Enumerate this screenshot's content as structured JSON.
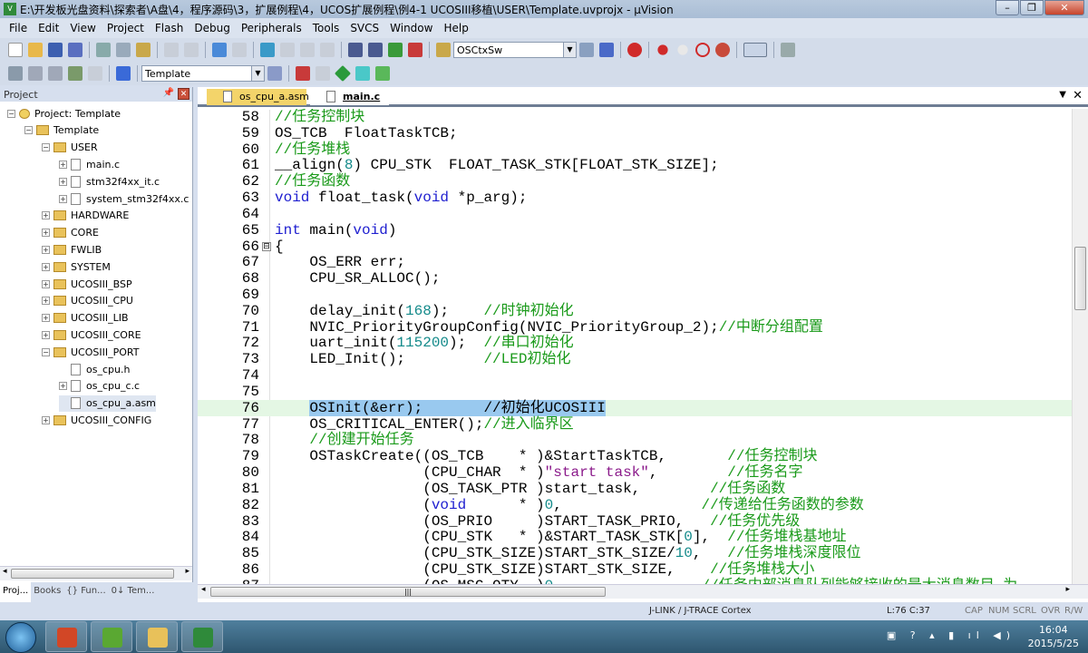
{
  "window": {
    "title": "E:\\开发板光盘资料\\探索者\\A盘\\4，程序源码\\3，扩展例程\\4，UCOS扩展例程\\例4-1 UCOSIII移植\\USER\\Template.uvprojx - µVision",
    "icon": "uvision-icon",
    "buttons": [
      "–",
      "❐",
      "✕"
    ]
  },
  "menu": [
    "File",
    "Edit",
    "View",
    "Project",
    "Flash",
    "Debug",
    "Peripherals",
    "Tools",
    "SVCS",
    "Window",
    "Help"
  ],
  "toolbar": {
    "find_combo": "OSCtxSw",
    "target_combo": "Template"
  },
  "project_panel": {
    "title": "Project",
    "pin": "ᵖ",
    "close": "✕",
    "tree": [
      {
        "label": "Project: Template",
        "level": 0,
        "type": "root",
        "exp": "−"
      },
      {
        "label": "Template",
        "level": 1,
        "type": "folder",
        "exp": "−"
      },
      {
        "label": "USER",
        "level": 2,
        "type": "folder",
        "exp": "−"
      },
      {
        "label": "main.c",
        "level": 3,
        "type": "file",
        "exp": "+"
      },
      {
        "label": "stm32f4xx_it.c",
        "level": 3,
        "type": "file",
        "exp": "+"
      },
      {
        "label": "system_stm32f4xx.c",
        "level": 3,
        "type": "file",
        "exp": "+"
      },
      {
        "label": "HARDWARE",
        "level": 2,
        "type": "folder",
        "exp": "+"
      },
      {
        "label": "CORE",
        "level": 2,
        "type": "folder",
        "exp": "+"
      },
      {
        "label": "FWLIB",
        "level": 2,
        "type": "folder",
        "exp": "+"
      },
      {
        "label": "SYSTEM",
        "level": 2,
        "type": "folder",
        "exp": "+"
      },
      {
        "label": "UCOSIII_BSP",
        "level": 2,
        "type": "folder",
        "exp": "+"
      },
      {
        "label": "UCOSIII_CPU",
        "level": 2,
        "type": "folder",
        "exp": "+"
      },
      {
        "label": "UCOSIII_LIB",
        "level": 2,
        "type": "folder",
        "exp": "+"
      },
      {
        "label": "UCOSIII_CORE",
        "level": 2,
        "type": "folder",
        "exp": "+"
      },
      {
        "label": "UCOSIII_PORT",
        "level": 2,
        "type": "folder",
        "exp": "−"
      },
      {
        "label": "os_cpu.h",
        "level": 3,
        "type": "file",
        "exp": ""
      },
      {
        "label": "os_cpu_c.c",
        "level": 3,
        "type": "file",
        "exp": "+"
      },
      {
        "label": "os_cpu_a.asm",
        "level": 3,
        "type": "file",
        "exp": "",
        "selected": true
      },
      {
        "label": "UCOSIII_CONFIG",
        "level": 2,
        "type": "folder",
        "exp": "+"
      }
    ],
    "tabs": [
      "Proj...",
      "Books",
      "{} Fun...",
      "0↓ Tem..."
    ]
  },
  "editor": {
    "tabs": [
      {
        "label": "os_cpu_a.asm",
        "active": false
      },
      {
        "label": "main.c",
        "active": true
      }
    ],
    "current_line": 76,
    "lines": [
      {
        "no": 58,
        "seg": [
          [
            "//任务控制块",
            "c"
          ]
        ]
      },
      {
        "no": 59,
        "seg": [
          [
            "OS_TCB  FloatTaskTCB;",
            ""
          ]
        ]
      },
      {
        "no": 60,
        "seg": [
          [
            "//任务堆栈",
            "c"
          ]
        ]
      },
      {
        "no": 61,
        "seg": [
          [
            "__align(",
            ""
          ],
          [
            "8",
            "n"
          ],
          [
            ") CPU_STK  FLOAT_TASK_STK[FLOAT_STK_SIZE];",
            ""
          ]
        ]
      },
      {
        "no": 62,
        "seg": [
          [
            "//任务函数",
            "c"
          ]
        ]
      },
      {
        "no": 63,
        "seg": [
          [
            "void",
            "k"
          ],
          [
            " float_task(",
            ""
          ],
          [
            "void",
            "k"
          ],
          [
            " *p_arg);",
            ""
          ]
        ]
      },
      {
        "no": 64,
        "seg": []
      },
      {
        "no": 65,
        "seg": [
          [
            "int",
            "k"
          ],
          [
            " main(",
            ""
          ],
          [
            "void",
            "k"
          ],
          [
            ")",
            ""
          ]
        ]
      },
      {
        "no": 66,
        "seg": [
          [
            "{",
            ""
          ]
        ],
        "fold": "⊟"
      },
      {
        "no": 67,
        "seg": [
          [
            "    OS_ERR err;",
            ""
          ]
        ]
      },
      {
        "no": 68,
        "seg": [
          [
            "    CPU_SR_ALLOC();",
            ""
          ]
        ]
      },
      {
        "no": 69,
        "seg": []
      },
      {
        "no": 70,
        "seg": [
          [
            "    delay_init(",
            ""
          ],
          [
            "168",
            "n"
          ],
          [
            ");    ",
            ""
          ],
          [
            "//时钟初始化",
            "c"
          ]
        ]
      },
      {
        "no": 71,
        "seg": [
          [
            "    NVIC_PriorityGroupConfig(NVIC_PriorityGroup_2);",
            ""
          ],
          [
            "//中断分组配置",
            "c"
          ]
        ]
      },
      {
        "no": 72,
        "seg": [
          [
            "    uart_init(",
            ""
          ],
          [
            "115200",
            "n"
          ],
          [
            ");  ",
            ""
          ],
          [
            "//串口初始化",
            "c"
          ]
        ]
      },
      {
        "no": 73,
        "seg": [
          [
            "    LED_Init();         ",
            ""
          ],
          [
            "//LED初始化",
            "c"
          ]
        ]
      },
      {
        "no": 74,
        "seg": []
      },
      {
        "no": 75,
        "seg": []
      },
      {
        "no": 76,
        "seg": [
          [
            "    ",
            ""
          ],
          [
            "OSInit(&err);       //初始化UCOSIII",
            "hl"
          ]
        ]
      },
      {
        "no": 77,
        "seg": [
          [
            "    OS_CRITICAL_ENTER();",
            ""
          ],
          [
            "//进入临界区",
            "c"
          ]
        ]
      },
      {
        "no": 78,
        "seg": [
          [
            "    ",
            ""
          ],
          [
            "//创建开始任务",
            "c"
          ]
        ]
      },
      {
        "no": 79,
        "seg": [
          [
            "    OSTaskCreate((OS_TCB    * )&StartTaskTCB,       ",
            ""
          ],
          [
            "//任务控制块",
            "c"
          ]
        ]
      },
      {
        "no": 80,
        "seg": [
          [
            "                 (CPU_CHAR  * )",
            ""
          ],
          [
            "\"start task\"",
            "s"
          ],
          [
            ",        ",
            ""
          ],
          [
            "//任务名字",
            "c"
          ]
        ]
      },
      {
        "no": 81,
        "seg": [
          [
            "                 (OS_TASK_PTR )start_task,        ",
            ""
          ],
          [
            "//任务函数",
            "c"
          ]
        ]
      },
      {
        "no": 82,
        "seg": [
          [
            "                 (",
            ""
          ],
          [
            "void",
            "k"
          ],
          [
            "      * )",
            ""
          ],
          [
            "0",
            "n"
          ],
          [
            ",                ",
            ""
          ],
          [
            "//传递给任务函数的参数",
            "c"
          ]
        ]
      },
      {
        "no": 83,
        "seg": [
          [
            "                 (OS_PRIO     )START_TASK_PRIO,   ",
            ""
          ],
          [
            "//任务优先级",
            "c"
          ]
        ]
      },
      {
        "no": 84,
        "seg": [
          [
            "                 (CPU_STK   * )&START_TASK_STK[",
            ""
          ],
          [
            "0",
            "n"
          ],
          [
            "],  ",
            ""
          ],
          [
            "//任务堆栈基地址",
            "c"
          ]
        ]
      },
      {
        "no": 85,
        "seg": [
          [
            "                 (CPU_STK_SIZE)START_STK_SIZE/",
            ""
          ],
          [
            "10",
            "n"
          ],
          [
            ",   ",
            ""
          ],
          [
            "//任务堆栈深度限位",
            "c"
          ]
        ]
      },
      {
        "no": 86,
        "seg": [
          [
            "                 (CPU_STK_SIZE)START_STK_SIZE,    ",
            ""
          ],
          [
            "//任务堆栈大小",
            "c"
          ]
        ]
      },
      {
        "no": 87,
        "seg": [
          [
            "                 (OS_MSG_QTY  )",
            ""
          ],
          [
            "0",
            "n"
          ],
          [
            ",                ",
            ""
          ],
          [
            "//任务内部消息队列能够接收的最大消息数目,为",
            "c"
          ]
        ]
      }
    ]
  },
  "status": {
    "debugger": "J-LINK / J-TRACE Cortex",
    "position": "L:76 C:37",
    "indicators": [
      "CAP",
      "NUM",
      "SCRL",
      "OVR",
      "R/W"
    ]
  },
  "taskbar": {
    "apps": [
      {
        "name": "powerpoint",
        "color": "#d24726"
      },
      {
        "name": "app-green",
        "color": "#5aa832"
      },
      {
        "name": "explorer",
        "color": "#e8c15a"
      },
      {
        "name": "uvision",
        "color": "#2f8a3a"
      }
    ],
    "time": "16:04",
    "date": "2015/5/25"
  }
}
